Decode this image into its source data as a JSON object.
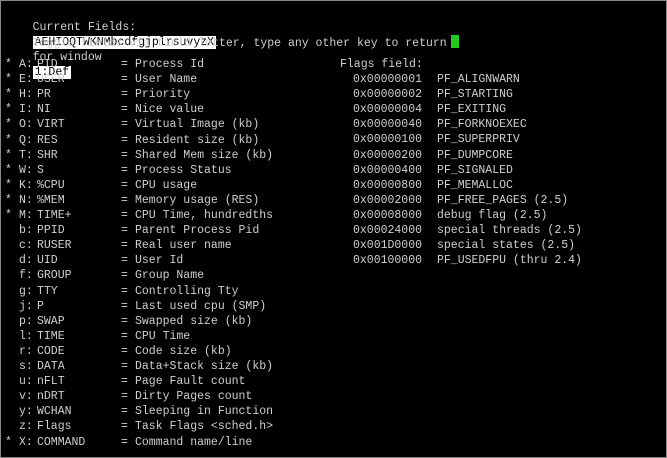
{
  "header": {
    "current_fields_label": "Current Fields:",
    "current_fields_value": "AEHIOQTWKNMbcdfgjplrsuvyzX",
    "for_window_label": "for window",
    "window_value": "1:Def",
    "instructions": "Toggle fields via field letter, type any other key to return"
  },
  "fields": [
    {
      "star": "*",
      "key": "A:",
      "name": "PID",
      "desc": "Process Id"
    },
    {
      "star": "*",
      "key": "E:",
      "name": "USER",
      "desc": "User Name"
    },
    {
      "star": "*",
      "key": "H:",
      "name": "PR",
      "desc": "Priority"
    },
    {
      "star": "*",
      "key": "I:",
      "name": "NI",
      "desc": "Nice value"
    },
    {
      "star": "*",
      "key": "O:",
      "name": "VIRT",
      "desc": "Virtual Image (kb)"
    },
    {
      "star": "*",
      "key": "Q:",
      "name": "RES",
      "desc": "Resident size (kb)"
    },
    {
      "star": "*",
      "key": "T:",
      "name": "SHR",
      "desc": "Shared Mem size (kb)"
    },
    {
      "star": "*",
      "key": "W:",
      "name": "S",
      "desc": "Process Status"
    },
    {
      "star": "*",
      "key": "K:",
      "name": "%CPU",
      "desc": "CPU usage"
    },
    {
      "star": "*",
      "key": "N:",
      "name": "%MEM",
      "desc": "Memory usage (RES)"
    },
    {
      "star": "*",
      "key": "M:",
      "name": "TIME+",
      "desc": "CPU Time, hundredths"
    },
    {
      "star": "",
      "key": "b:",
      "name": "PPID",
      "desc": "Parent Process Pid"
    },
    {
      "star": "",
      "key": "c:",
      "name": "RUSER",
      "desc": "Real user name"
    },
    {
      "star": "",
      "key": "d:",
      "name": "UID",
      "desc": "User Id"
    },
    {
      "star": "",
      "key": "f:",
      "name": "GROUP",
      "desc": "Group Name"
    },
    {
      "star": "",
      "key": "g:",
      "name": "TTY",
      "desc": "Controlling Tty"
    },
    {
      "star": "",
      "key": "j:",
      "name": "P",
      "desc": "Last used cpu (SMP)"
    },
    {
      "star": "",
      "key": "p:",
      "name": "SWAP",
      "desc": "Swapped size (kb)"
    },
    {
      "star": "",
      "key": "l:",
      "name": "TIME",
      "desc": "CPU Time"
    },
    {
      "star": "",
      "key": "r:",
      "name": "CODE",
      "desc": "Code size (kb)"
    },
    {
      "star": "",
      "key": "s:",
      "name": "DATA",
      "desc": "Data+Stack size (kb)"
    },
    {
      "star": "",
      "key": "u:",
      "name": "nFLT",
      "desc": "Page Fault count"
    },
    {
      "star": "",
      "key": "v:",
      "name": "nDRT",
      "desc": "Dirty Pages count"
    },
    {
      "star": "",
      "key": "y:",
      "name": "WCHAN",
      "desc": "Sleeping in Function"
    },
    {
      "star": "",
      "key": "z:",
      "name": "Flags",
      "desc": "Task Flags <sched.h>"
    },
    {
      "star": "*",
      "key": "X:",
      "name": "COMMAND",
      "desc": "Command name/line"
    }
  ],
  "flags_title": "Flags field:",
  "flags": [
    {
      "hex": "0x00000001",
      "name": "PF_ALIGNWARN"
    },
    {
      "hex": "0x00000002",
      "name": "PF_STARTING"
    },
    {
      "hex": "0x00000004",
      "name": "PF_EXITING"
    },
    {
      "hex": "0x00000040",
      "name": "PF_FORKNOEXEC"
    },
    {
      "hex": "0x00000100",
      "name": "PF_SUPERPRIV"
    },
    {
      "hex": "0x00000200",
      "name": "PF_DUMPCORE"
    },
    {
      "hex": "0x00000400",
      "name": "PF_SIGNALED"
    },
    {
      "hex": "0x00000800",
      "name": "PF_MEMALLOC"
    },
    {
      "hex": "0x00002000",
      "name": "PF_FREE_PAGES (2.5)"
    },
    {
      "hex": "0x00008000",
      "name": "debug flag (2.5)"
    },
    {
      "hex": "0x00024000",
      "name": "special threads (2.5)"
    },
    {
      "hex": "0x001D0000",
      "name": "special states (2.5)"
    },
    {
      "hex": "0x00100000",
      "name": "PF_USEDFPU (thru 2.4)"
    }
  ],
  "colors": {
    "background": "#000000",
    "foreground": "#cfcfcf",
    "highlight": "#ffffff",
    "cursor": "#22cc22"
  }
}
